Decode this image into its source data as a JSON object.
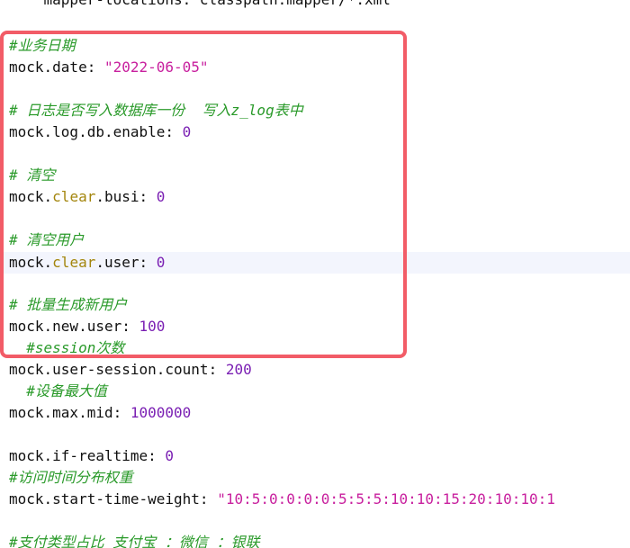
{
  "lines": [
    {
      "indent": "    ",
      "key": "mapper-locations",
      "sep": ": ",
      "value": "classpath:mapper/*.xml"
    },
    {
      "comment": "#业务日期"
    },
    {
      "key": "mock.date",
      "sep": ": ",
      "value": "\"2022-06-05\""
    },
    {
      "comment": "# 日志是否写入数据库一份  写入z_log表中"
    },
    {
      "key": "mock.log.db.enable",
      "sep": ": ",
      "value": "0"
    },
    {
      "comment": "# 清空"
    },
    {
      "key_pre": "mock.",
      "key_kw": "clear",
      "key_post": ".busi",
      "sep": ": ",
      "value": "0"
    },
    {
      "comment": "# 清空用户"
    },
    {
      "key_pre": "mock.",
      "key_kw": "clear",
      "key_post": ".user",
      "sep": ": ",
      "value": "0"
    },
    {
      "comment": "# 批量生成新用户"
    },
    {
      "key": "mock.new.user",
      "sep": ": ",
      "value": "100"
    },
    {
      "indent": "  ",
      "comment": "#session次数"
    },
    {
      "key": "mock.user-session.count",
      "sep": ": ",
      "value": "200"
    },
    {
      "indent": "  ",
      "comment": "#设备最大值"
    },
    {
      "key": "mock.max.mid",
      "sep": ": ",
      "value": "1000000"
    },
    {
      "key": "mock.if-realtime",
      "sep": ": ",
      "value": "0"
    },
    {
      "comment": "#访问时间分布权重"
    },
    {
      "key": "mock.start-time-weight",
      "sep": ": ",
      "value": "\"10:5:0:0:0:0:5:5:5:10:10:15:20:10:10:1"
    },
    {
      "comment": "#支付类型占比 支付宝 ：微信 ：银联"
    }
  ],
  "colors": {
    "highlight_border": "#f25c67",
    "comment": "#2a9a2a",
    "string": "#c8209e",
    "number": "#7a1fb3",
    "keyword": "#a3850c",
    "current_line_bg": "#f3f5fd"
  }
}
